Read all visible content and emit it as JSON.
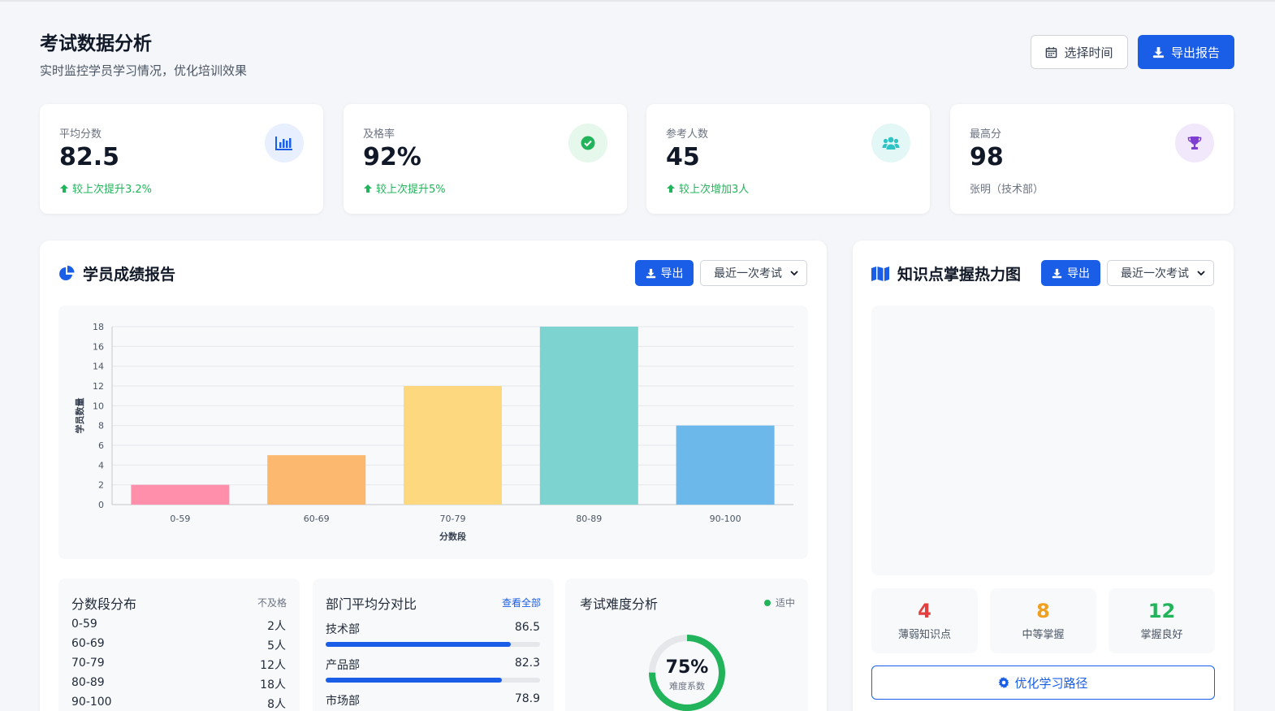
{
  "header": {
    "title": "考试数据分析",
    "subtitle": "实时监控学员学习情况，优化培训效果",
    "time_button": "选择时间",
    "export_button": "导出报告"
  },
  "stats": [
    {
      "label": "平均分数",
      "value": "82.5",
      "change": "较上次提升3.2%",
      "icon": "bar-chart-icon",
      "icon_color": "#1a5ee8",
      "icon_bg": "#e8efff"
    },
    {
      "label": "及格率",
      "value": "92%",
      "change": "较上次提升5%",
      "icon": "check-circle-icon",
      "icon_color": "#22b45a",
      "icon_bg": "#e6f7ec"
    },
    {
      "label": "参考人数",
      "value": "45",
      "change": "较上次增加3人",
      "icon": "users-icon",
      "icon_color": "#2ec4c4",
      "icon_bg": "#e3f7f6"
    },
    {
      "label": "最高分",
      "value": "98",
      "note": "张明（技术部）",
      "icon": "trophy-icon",
      "icon_color": "#7e3fd1",
      "icon_bg": "#f1e9fb"
    }
  ],
  "report": {
    "title": "学员成绩报告",
    "export_label": "导出",
    "select_value": "最近一次考试",
    "score_dist": {
      "title": "分数段分布",
      "tag": "不及格",
      "rows": [
        {
          "range": "0-59",
          "count": "2人"
        },
        {
          "range": "60-69",
          "count": "5人"
        },
        {
          "range": "70-79",
          "count": "12人"
        },
        {
          "range": "80-89",
          "count": "18人"
        },
        {
          "range": "90-100",
          "count": "8人"
        }
      ]
    },
    "dept": {
      "title": "部门平均分对比",
      "link": "查看全部",
      "rows": [
        {
          "name": "技术部",
          "score": "86.5",
          "fill": 0.865
        },
        {
          "name": "产品部",
          "score": "82.3",
          "fill": 0.823
        },
        {
          "name": "市场部",
          "score": "78.9",
          "fill": 0.789
        }
      ]
    },
    "difficulty": {
      "title": "考试难度分析",
      "tag": "适中",
      "percent": "75%",
      "label": "难度系数",
      "value": 0.75
    }
  },
  "heatmap": {
    "title": "知识点掌握热力图",
    "export_label": "导出",
    "select_value": "最近一次考试",
    "stats": [
      {
        "num": "4",
        "label": "薄弱知识点",
        "color": "#e53e3e"
      },
      {
        "num": "8",
        "label": "中等掌握",
        "color": "#f0a020"
      },
      {
        "num": "12",
        "label": "掌握良好",
        "color": "#22b45a"
      }
    ],
    "optimize_button": "优化学习路径"
  },
  "chart_data": {
    "type": "bar",
    "categories": [
      "0-59",
      "60-69",
      "70-79",
      "80-89",
      "90-100"
    ],
    "values": [
      2,
      5,
      12,
      18,
      8
    ],
    "colors": [
      "#ff8fab",
      "#fbb86e",
      "#fdd87e",
      "#7dd3cf",
      "#6cb8ea"
    ],
    "xlabel": "分数段",
    "ylabel": "学员数量",
    "ylim": [
      0,
      18
    ],
    "yticks": [
      0,
      2,
      4,
      6,
      8,
      10,
      12,
      14,
      16,
      18
    ],
    "grid": true
  }
}
